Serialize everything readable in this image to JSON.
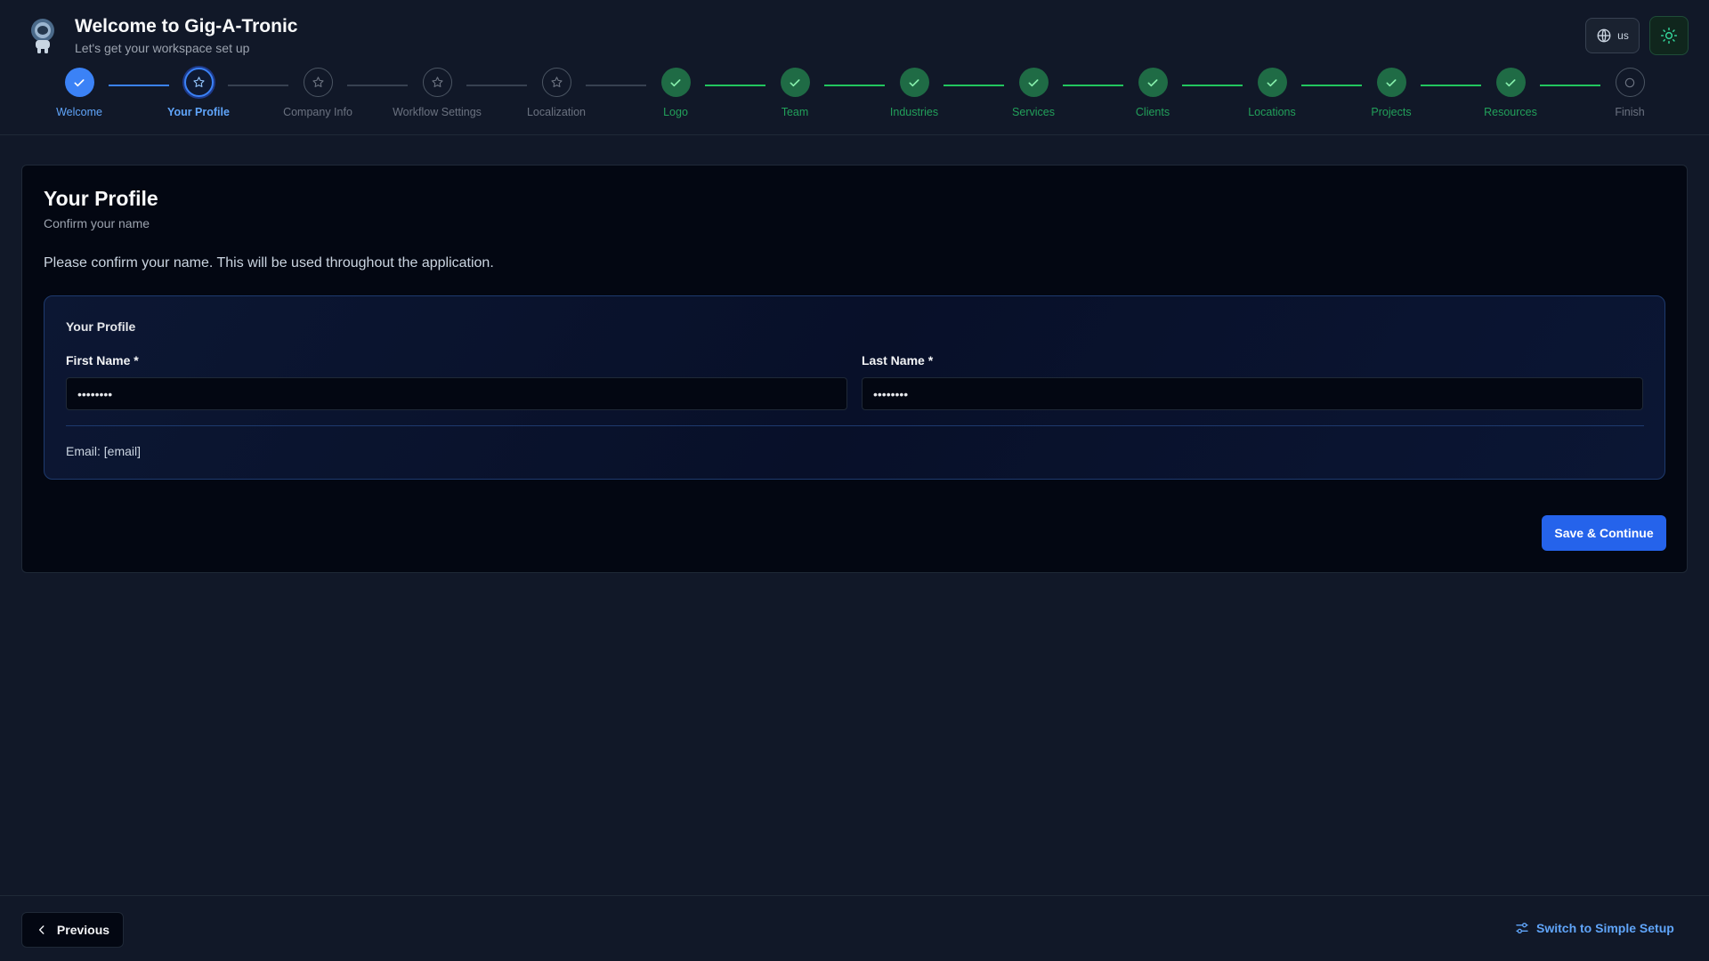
{
  "header": {
    "title": "Welcome to Gig-A-Tronic",
    "subtitle": "Let's get your workspace set up",
    "language_code": "us",
    "logo_icon": "astronaut-icon"
  },
  "stepper": {
    "steps": [
      {
        "label": "Welcome",
        "state": "done"
      },
      {
        "label": "Your Profile",
        "state": "current"
      },
      {
        "label": "Company Info",
        "state": "pending"
      },
      {
        "label": "Workflow Settings",
        "state": "pending"
      },
      {
        "label": "Localization",
        "state": "pending"
      },
      {
        "label": "Logo",
        "state": "complete"
      },
      {
        "label": "Team",
        "state": "complete"
      },
      {
        "label": "Industries",
        "state": "complete"
      },
      {
        "label": "Services",
        "state": "complete"
      },
      {
        "label": "Clients",
        "state": "complete"
      },
      {
        "label": "Locations",
        "state": "complete"
      },
      {
        "label": "Projects",
        "state": "complete"
      },
      {
        "label": "Resources",
        "state": "complete"
      },
      {
        "label": "Finish",
        "state": "final"
      }
    ]
  },
  "card": {
    "title": "Your Profile",
    "subtitle": "Confirm your name",
    "description": "Please confirm your name. This will be used throughout the application.",
    "section_title": "Your Profile",
    "first_name_label": "First Name *",
    "first_name_value": "••••••••",
    "last_name_label": "Last Name *",
    "last_name_value": "••••••••",
    "email_text": "Email: [email]",
    "save_label": "Save & Continue"
  },
  "footer": {
    "previous_label": "Previous",
    "simple_setup_label": "Switch to Simple Setup"
  },
  "colors": {
    "background": "#111828",
    "card": "#030712",
    "accent_blue": "#2563eb",
    "complete_green": "#1f6b45",
    "link_blue": "#60a5fa"
  }
}
